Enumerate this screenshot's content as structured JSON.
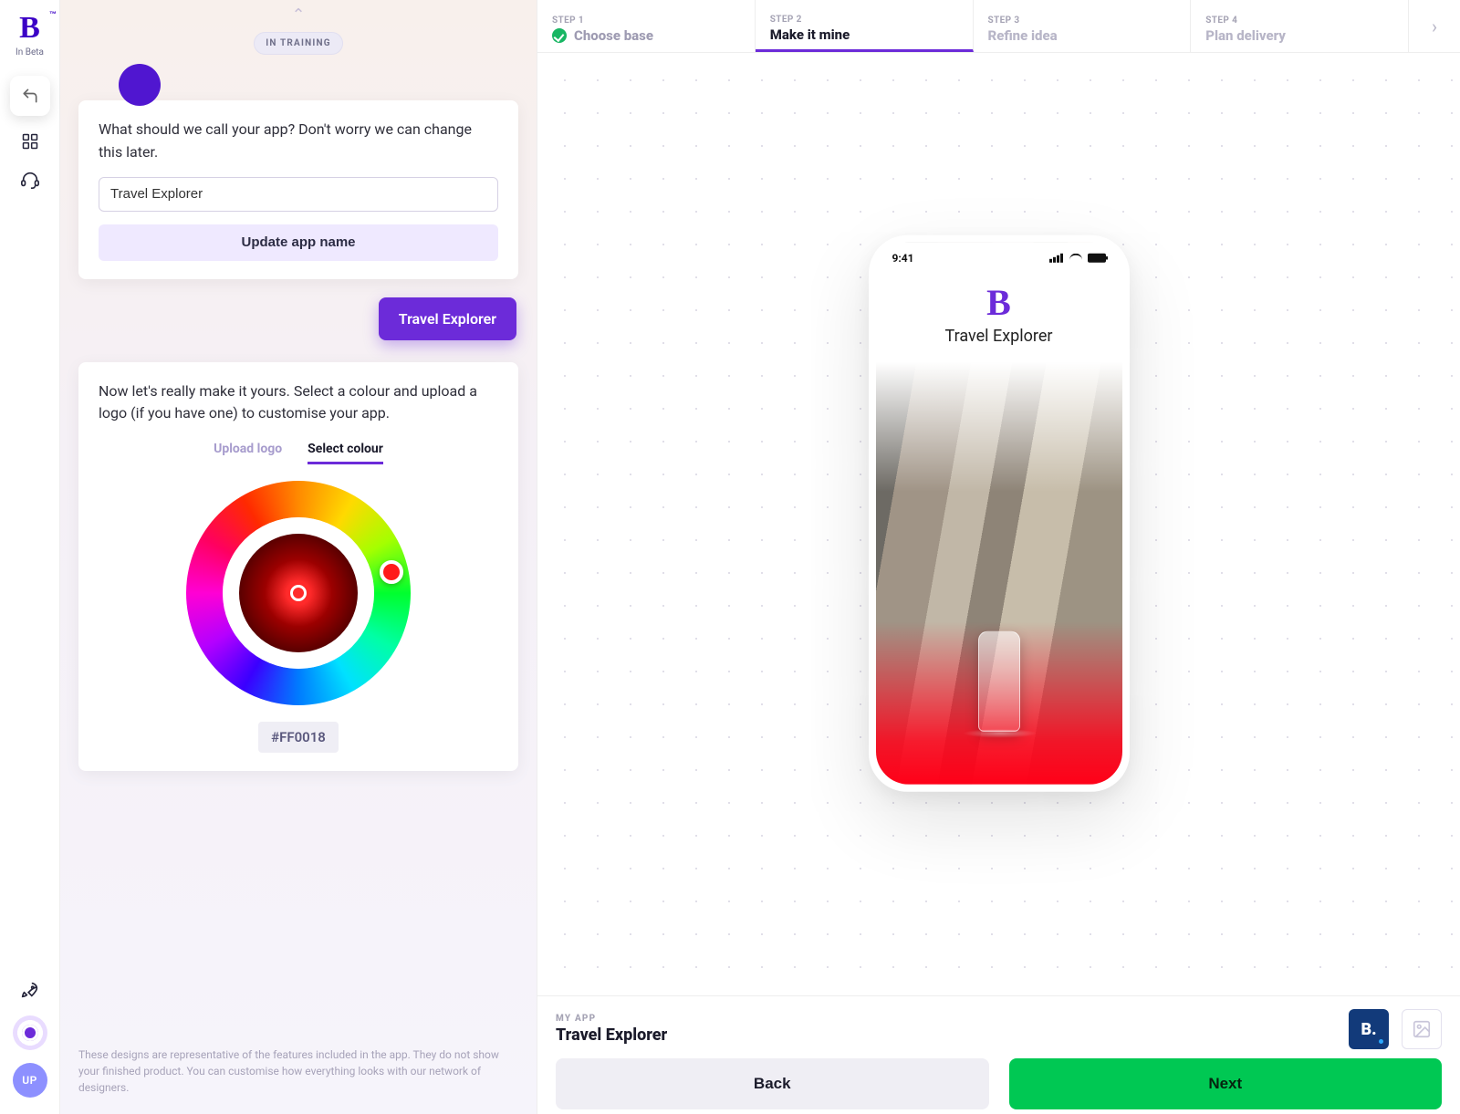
{
  "brand": {
    "logo_letter": "B",
    "tm": "™",
    "tagline": "In Beta"
  },
  "rail": {
    "avatar_initials": "UP"
  },
  "chat": {
    "training_badge": "IN TRAINING",
    "q_name": "What should we call your app? Don't worry we can change this later.",
    "app_name_value": "Travel Explorer",
    "update_btn": "Update app name",
    "user_reply": "Travel Explorer",
    "q_customise": "Now let's really make it yours. Select a colour and upload a logo (if you have one) to customise your app.",
    "tabs": {
      "upload": "Upload logo",
      "select": "Select colour"
    },
    "hex": "#FF0018",
    "disclaimer": "These designs are representative of the features included in the app. They do not show your finished product. You can customise how everything looks with our network of designers."
  },
  "stepper": {
    "steps": [
      {
        "eyebrow": "STEP 1",
        "label": "Choose base"
      },
      {
        "eyebrow": "STEP 2",
        "label": "Make it mine"
      },
      {
        "eyebrow": "STEP 3",
        "label": "Refine idea"
      },
      {
        "eyebrow": "STEP 4",
        "label": "Plan delivery"
      }
    ]
  },
  "preview": {
    "time": "9:41",
    "splash_title": "Travel Explorer",
    "logo_letter": "B."
  },
  "footer": {
    "eyebrow": "MY APP",
    "app_name": "Travel Explorer",
    "brand_tile_letter": "B.",
    "back": "Back",
    "next": "Next"
  },
  "colors": {
    "accent": "#6c2bd9",
    "selected": "#FF0018",
    "success": "#00c853"
  }
}
